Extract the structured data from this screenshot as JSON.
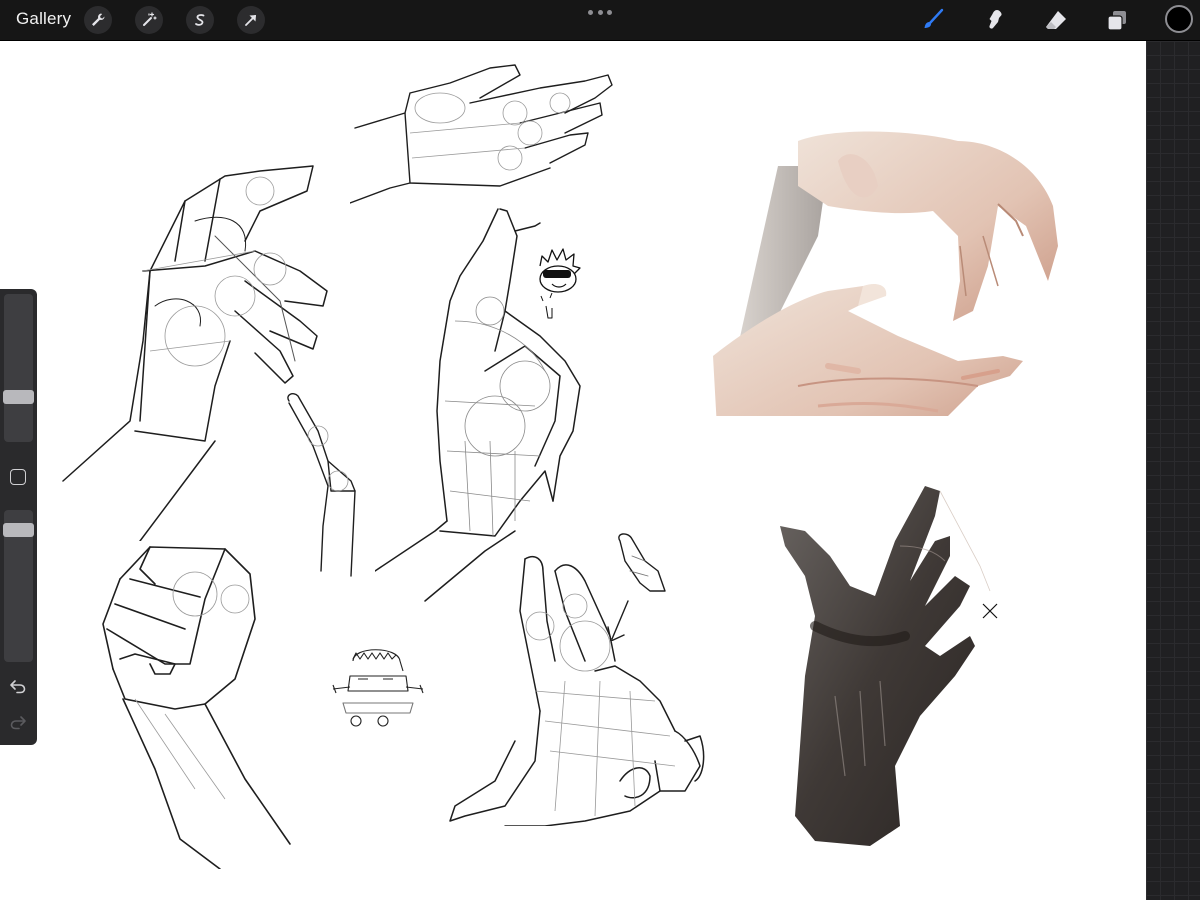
{
  "toolbar": {
    "gallery_label": "Gallery",
    "left_tools": [
      "wrench-icon",
      "magic-wand-icon",
      "selection-s-icon",
      "transform-arrow-icon"
    ],
    "right_tools": [
      "brush-icon",
      "smudge-icon",
      "eraser-icon",
      "layers-icon"
    ],
    "active_tool": "brush-icon",
    "active_color": "#000000",
    "accent_color": "#1a73e8"
  },
  "sidebar": {
    "size_slider_level": 0.28,
    "opacity_slider_level": 0.92,
    "modify_button": "square-icon",
    "undo": "undo-icon",
    "redo": "redo-icon"
  },
  "canvas": {
    "background": "#ffffff",
    "sketches": [
      "hand-sketch-reaching",
      "hand-sketch-flat",
      "finger-sketch",
      "hand-sketch-pointing",
      "doodle-spiky-face",
      "hand-sketch-fist",
      "doodle-blob-character",
      "hand-sketch-spread",
      "finger-sketch-small",
      "painted-hands-pale",
      "painted-hand-dark"
    ]
  }
}
